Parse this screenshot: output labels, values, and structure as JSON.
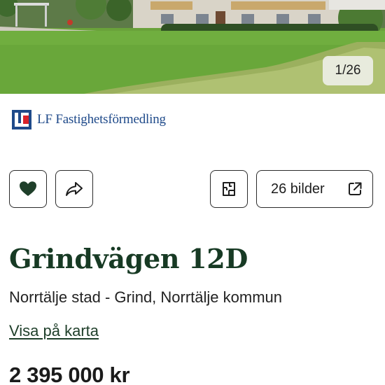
{
  "gallery": {
    "counter": "1/26"
  },
  "agency": {
    "name": "LF Fastighetsförmedling",
    "brand_color": "#1f4a8a",
    "accent_color": "#d8232a"
  },
  "actions": {
    "favorite_icon": "heart-icon",
    "share_icon": "share-arrow-icon",
    "floorplan_icon": "floorplan-icon",
    "images_label": "26 bilder",
    "images_icon": "external-link-icon"
  },
  "listing": {
    "title": "Grindvägen 12D",
    "location": "Norrtälje stad - Grind, Norrtälje kommun",
    "map_link": "Visa på karta",
    "price": "2 395 000 kr"
  },
  "colors": {
    "title": "#173a24",
    "heart": "#1f3f2a",
    "button_border": "#2b2b2b"
  }
}
